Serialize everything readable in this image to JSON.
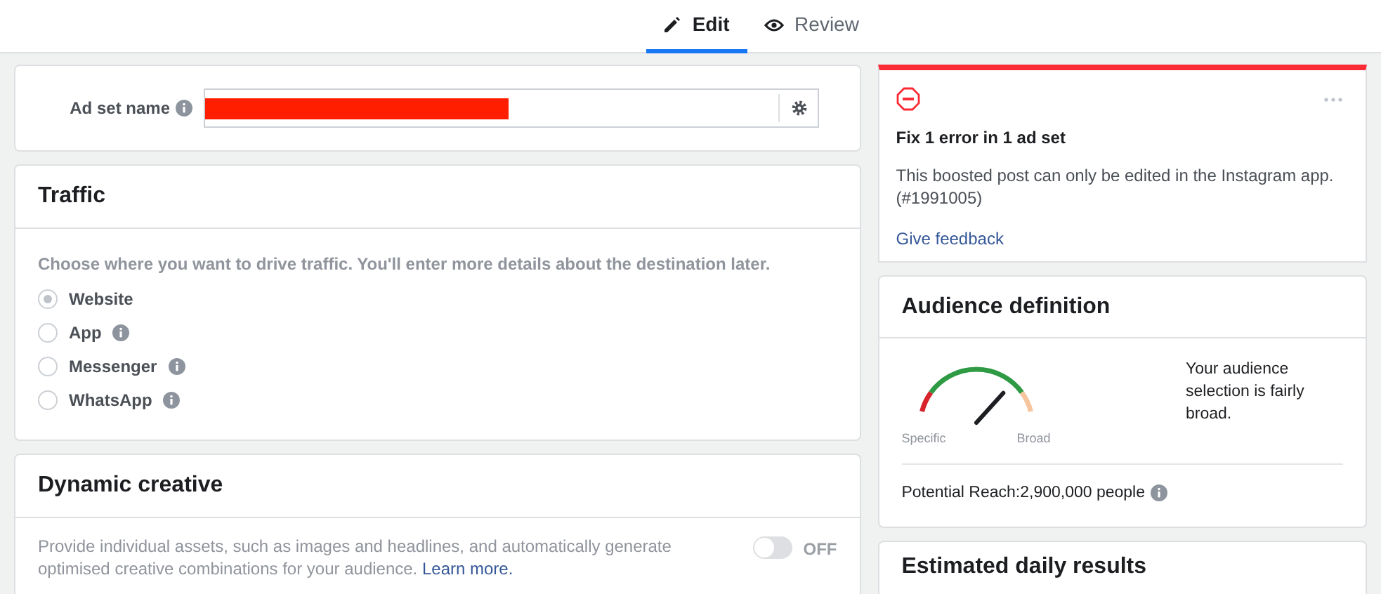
{
  "tabs": [
    {
      "label": "Edit",
      "selected": true,
      "kind": "pencil"
    },
    {
      "label": "Review",
      "selected": false,
      "kind": "eye"
    }
  ],
  "ad_set_name": {
    "label": "Ad set name",
    "redacted": true
  },
  "traffic": {
    "title": "Traffic",
    "description": "Choose where you want to drive traffic. You'll enter more details about the destination later.",
    "options": [
      {
        "label": "Website",
        "selected": true,
        "info": false
      },
      {
        "label": "App",
        "selected": false,
        "info": true
      },
      {
        "label": "Messenger",
        "selected": false,
        "info": true
      },
      {
        "label": "WhatsApp",
        "selected": false,
        "info": true
      }
    ]
  },
  "dynamic_creative": {
    "title": "Dynamic creative",
    "description": "Provide individual assets, such as images and headlines, and automatically generate optimised creative combinations for your audience.",
    "link": "Learn more.",
    "toggle": {
      "on": false,
      "label": "OFF"
    }
  },
  "error_card": {
    "title": "Fix 1 error in 1 ad set",
    "message": "This boosted post can only be edited in the Instagram app. (#1991005)",
    "link": "Give feedback"
  },
  "audience_definition": {
    "title": "Audience definition",
    "gauge": {
      "level": 0.72,
      "min_label": "Specific",
      "max_label": "Broad"
    },
    "summary": "Your audience selection is fairly broad.",
    "reach": "Potential Reach:2,900,000 people"
  },
  "estimated_daily_results": {
    "title": "Estimated daily results"
  }
}
